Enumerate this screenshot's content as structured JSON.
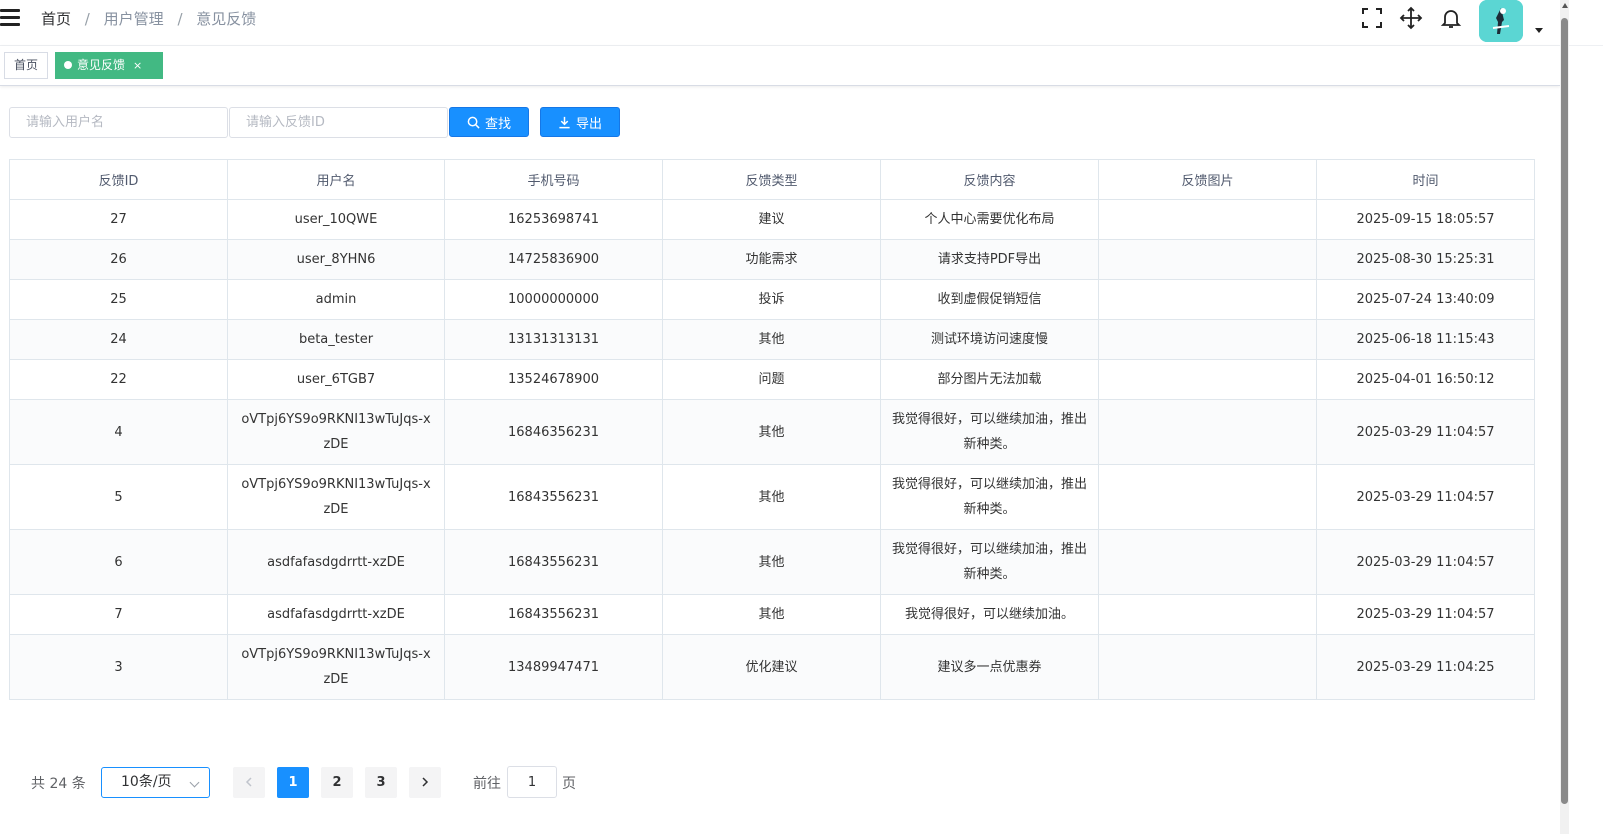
{
  "header": {
    "breadcrumb": [
      "首页",
      "用户管理",
      "意见反馈"
    ],
    "separator": "/",
    "icons": [
      "fullscreen-icon",
      "size-select-icon",
      "notification-bell-icon"
    ],
    "avatar_color": "#5bd6d3"
  },
  "tags": {
    "home": "首页",
    "active": "意见反馈",
    "close": "×",
    "active_color": "#42b983"
  },
  "search": {
    "username_placeholder": "请输入用户名",
    "feedback_id_placeholder": "请输入反馈ID",
    "search_label": "查找",
    "export_label": "导出",
    "button_color": "#1890ff"
  },
  "table": {
    "columns": [
      "反馈ID",
      "用户名",
      "手机号码",
      "反馈类型",
      "反馈内容",
      "反馈图片",
      "时间"
    ],
    "rows": [
      {
        "id": "27",
        "username": "user_10QWE",
        "phone": "16253698741",
        "type": "建议",
        "content": "个人中心需要优化布局",
        "image": "",
        "time": "2025-09-15 18:05:57"
      },
      {
        "id": "26",
        "username": "user_8YHN6",
        "phone": "14725836900",
        "type": "功能需求",
        "content": "请求支持PDF导出",
        "image": "",
        "time": "2025-08-30 15:25:31"
      },
      {
        "id": "25",
        "username": "admin",
        "phone": "10000000000",
        "type": "投诉",
        "content": "收到虚假促销短信",
        "image": "",
        "time": "2025-07-24 13:40:09"
      },
      {
        "id": "24",
        "username": "beta_tester",
        "phone": "13131313131",
        "type": "其他",
        "content": "测试环境访问速度慢",
        "image": "",
        "time": "2025-06-18 11:15:43"
      },
      {
        "id": "22",
        "username": "user_6TGB7",
        "phone": "13524678900",
        "type": "问题",
        "content": "部分图片无法加载",
        "image": "",
        "time": "2025-04-01 16:50:12"
      },
      {
        "id": "4",
        "username": "oVTpj6YS9o9RKNI13wTuJqs-xzDE",
        "phone": "16846356231",
        "type": "其他",
        "content": "我觉得很好，可以继续加油，推出新种类。",
        "image": "",
        "time": "2025-03-29 11:04:57"
      },
      {
        "id": "5",
        "username": "oVTpj6YS9o9RKNI13wTuJqs-xzDE",
        "phone": "16843556231",
        "type": "其他",
        "content": "我觉得很好，可以继续加油，推出新种类。",
        "image": "",
        "time": "2025-03-29 11:04:57"
      },
      {
        "id": "6",
        "username": "asdfafasdgdrrtt-xzDE",
        "phone": "16843556231",
        "type": "其他",
        "content": "我觉得很好，可以继续加油，推出新种类。",
        "image": "",
        "time": "2025-03-29 11:04:57"
      },
      {
        "id": "7",
        "username": "asdfafasdgdrrtt-xzDE",
        "phone": "16843556231",
        "type": "其他",
        "content": "我觉得很好，可以继续加油。",
        "image": "",
        "time": "2025-03-29 11:04:57"
      },
      {
        "id": "3",
        "username": "oVTpj6YS9o9RKNI13wTuJqs-xzDE",
        "phone": "13489947471",
        "type": "优化建议",
        "content": "建议多一点优惠券",
        "image": "",
        "time": "2025-03-29 11:04:25"
      }
    ]
  },
  "pagination": {
    "total_text": "共 24 条",
    "page_size": "10条/页",
    "pages": [
      "1",
      "2",
      "3"
    ],
    "current_page": "1",
    "goto_label": "前往",
    "goto_value": "1",
    "page_suffix": "页"
  }
}
